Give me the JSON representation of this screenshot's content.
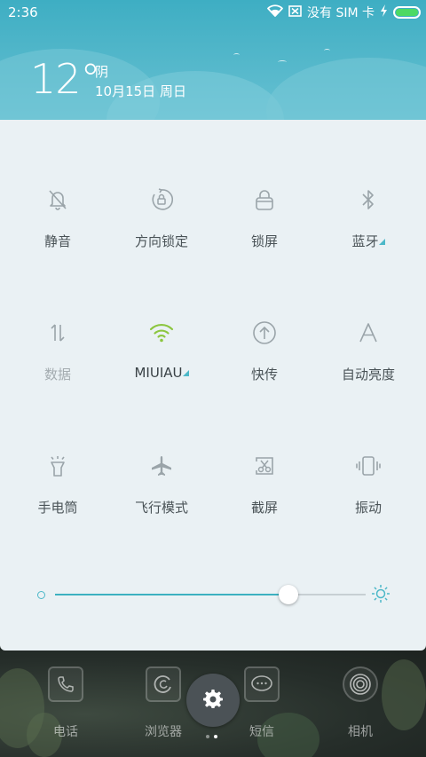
{
  "status_bar": {
    "time": "2:36",
    "carrier": "没有 SIM 卡",
    "icons": [
      "wifi-icon",
      "sim-icon",
      "charging-icon",
      "battery-icon"
    ]
  },
  "weather": {
    "temperature": "12°",
    "condition": "阴",
    "date": "10月15日 周日"
  },
  "toggles": [
    {
      "label": "静音",
      "icon": "bell-mute-icon",
      "active": false,
      "dim": false
    },
    {
      "label": "方向锁定",
      "icon": "rotation-lock-icon",
      "active": false,
      "dim": false
    },
    {
      "label": "锁屏",
      "icon": "lock-icon",
      "active": false,
      "dim": false
    },
    {
      "label": "蓝牙",
      "icon": "bluetooth-icon",
      "active": false,
      "dim": false,
      "has_more": true
    },
    {
      "label": "数据",
      "icon": "data-arrows-icon",
      "active": false,
      "dim": true
    },
    {
      "label": "MIUIAU",
      "icon": "wifi-icon",
      "active": true,
      "dim": false,
      "has_more": true
    },
    {
      "label": "快传",
      "icon": "upload-icon",
      "active": false,
      "dim": false
    },
    {
      "label": "自动亮度",
      "icon": "auto-brightness-icon",
      "active": false,
      "dim": false
    },
    {
      "label": "手电筒",
      "icon": "flashlight-icon",
      "active": false,
      "dim": false
    },
    {
      "label": "飞行模式",
      "icon": "airplane-icon",
      "active": false,
      "dim": false
    },
    {
      "label": "截屏",
      "icon": "screenshot-icon",
      "active": false,
      "dim": false
    },
    {
      "label": "振动",
      "icon": "vibrate-icon",
      "active": false,
      "dim": false
    }
  ],
  "brightness": {
    "level": 0.75
  },
  "dock": {
    "apps": [
      {
        "label": "电话",
        "icon": "phone-icon"
      },
      {
        "label": "浏览器",
        "icon": "browser-icon"
      },
      {
        "label": "短信",
        "icon": "message-icon"
      },
      {
        "label": "相机",
        "icon": "camera-icon"
      }
    ],
    "settings_icon": "gear-icon",
    "page_count": 2,
    "current_page": 2
  },
  "colors": {
    "accent": "#3db1c0",
    "wifi_active": "#8cc63f",
    "header": "#55b8cb",
    "panel": "#eaf1f4"
  }
}
